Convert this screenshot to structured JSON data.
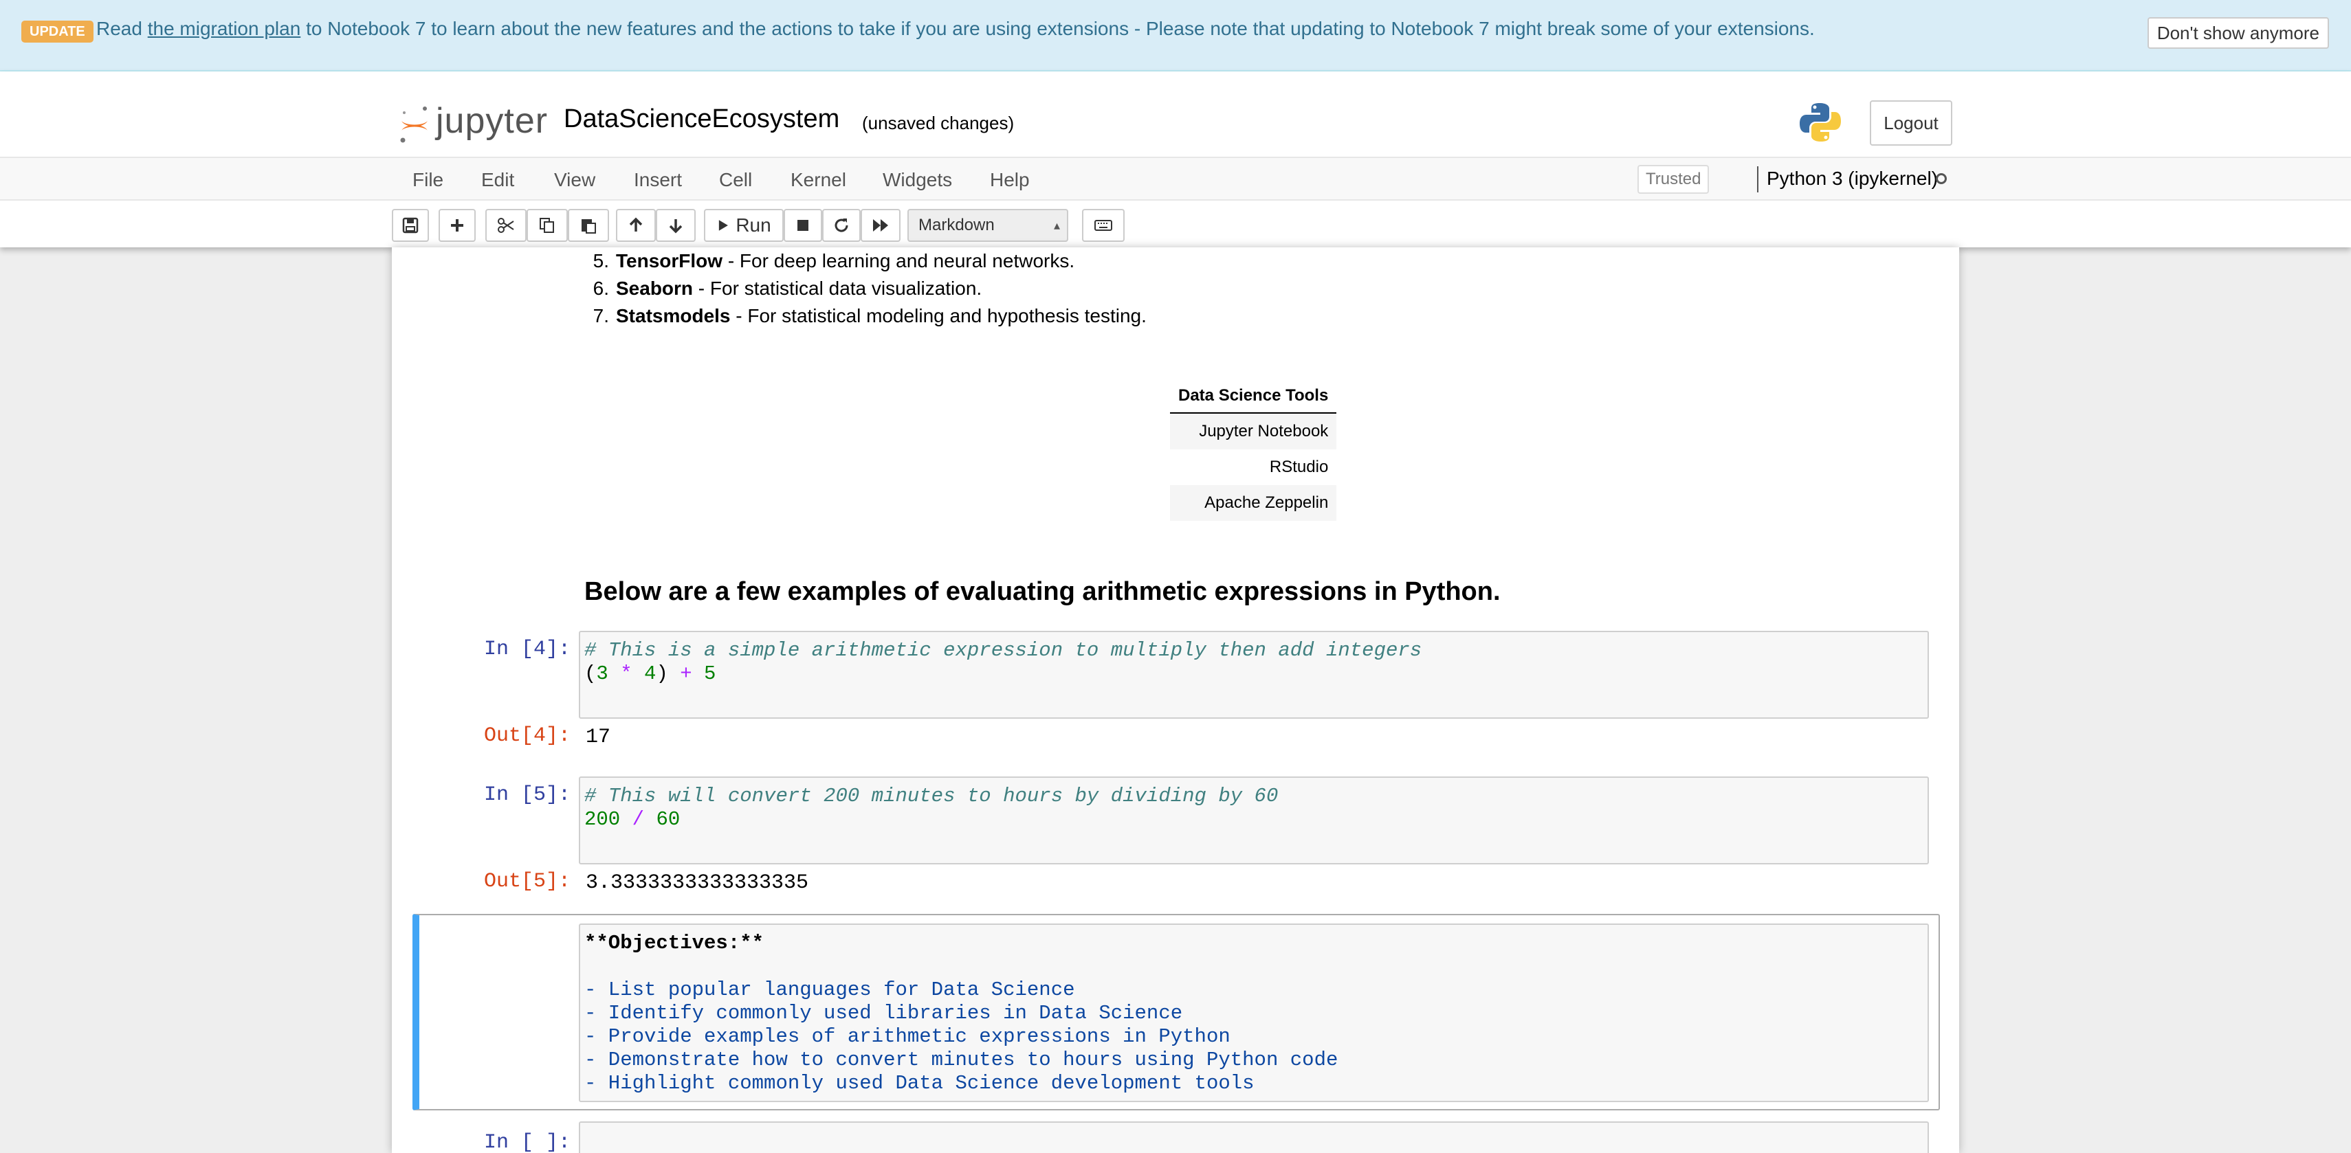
{
  "banner": {
    "badge": "UPDATE",
    "text_before": "Read",
    "link": "the migration plan",
    "text_after": "to Notebook 7 to learn about the new features and the actions to take if you are using extensions - Please note that updating to Notebook 7 might break some of your extensions.",
    "dismiss_label": "Don't show anymore"
  },
  "header": {
    "logo_text": "jupyter",
    "notebook_name": "DataScienceEcosystem",
    "save_status": "(unsaved changes)",
    "logout_label": "Logout"
  },
  "menu": {
    "items": [
      "File",
      "Edit",
      "View",
      "Insert",
      "Cell",
      "Kernel",
      "Widgets",
      "Help"
    ],
    "trusted": "Trusted",
    "kernel_name": "Python 3 (ipykernel)"
  },
  "toolbar": {
    "run_label": "Run",
    "cell_type": "Markdown"
  },
  "notebook": {
    "list_items": [
      {
        "num": "5.",
        "name": "TensorFlow",
        "desc": " - For deep learning and neural networks."
      },
      {
        "num": "6.",
        "name": "Seaborn",
        "desc": " - For statistical data visualization."
      },
      {
        "num": "7.",
        "name": "Statsmodels",
        "desc": " - For statistical modeling and hypothesis testing."
      }
    ],
    "tools_table": {
      "header": "Data Science Tools",
      "rows": [
        "Jupyter Notebook",
        "RStudio",
        "Apache Zeppelin"
      ]
    },
    "heading": "Below are a few examples of evaluating arithmetic expressions in Python.",
    "cells": [
      {
        "in_prompt": "In [4]:",
        "comment": "# This is a simple arithmetic expression to multiply then add integers",
        "code_parts": [
          "(",
          "3",
          " * ",
          "4",
          ") ",
          "+",
          " 5"
        ],
        "out_prompt": "Out[4]:",
        "output": "17"
      },
      {
        "in_prompt": "In [5]:",
        "comment": "# This will convert 200 minutes to hours by dividing by 60",
        "code_parts": [
          "200",
          " / ",
          "60"
        ],
        "out_prompt": "Out[5]:",
        "output": "3.3333333333333335"
      }
    ],
    "markdown_cell": {
      "title_line": "**Objectives:**",
      "lines": [
        "- List popular languages for Data Science",
        "- Identify commonly used libraries in Data Science",
        "- Provide examples of arithmetic expressions in Python",
        "- Demonstrate how to convert minutes to hours using Python code",
        "- Highlight commonly used Data Science development tools"
      ]
    },
    "empty_prompt": "In [ ]:"
  }
}
